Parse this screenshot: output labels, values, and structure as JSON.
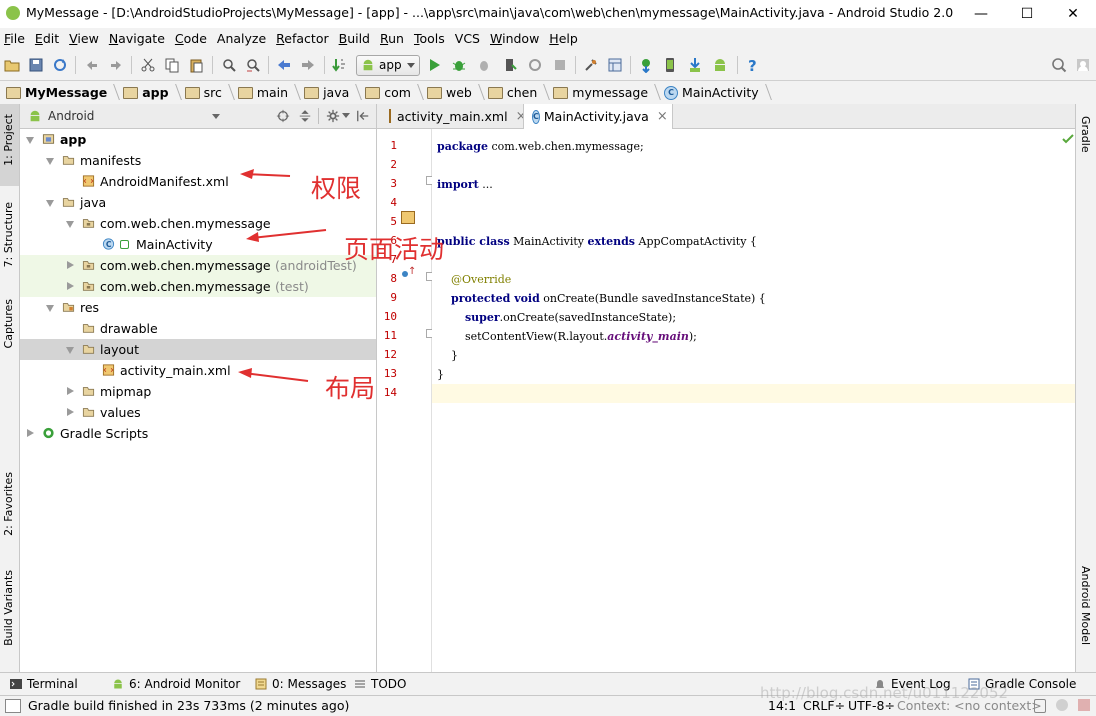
{
  "window": {
    "title": "MyMessage - [D:\\AndroidStudioProjects\\MyMessage] - [app] - ...\\app\\src\\main\\java\\com\\web\\chen\\mymessage\\MainActivity.java - Android Studio 2.0",
    "minimize": "—",
    "maximize": "☐",
    "close": "✕"
  },
  "menu": [
    {
      "label": "File",
      "u": "F",
      "rest": "ile"
    },
    {
      "label": "Edit",
      "u": "E",
      "rest": "dit"
    },
    {
      "label": "View",
      "u": "V",
      "rest": "iew"
    },
    {
      "label": "Navigate",
      "u": "N",
      "rest": "avigate"
    },
    {
      "label": "Code",
      "u": "C",
      "rest": "ode"
    },
    {
      "label": "Analyze",
      "u": "",
      "rest": "Analyze"
    },
    {
      "label": "Refactor",
      "u": "R",
      "rest": "efactor"
    },
    {
      "label": "Build",
      "u": "B",
      "rest": "uild"
    },
    {
      "label": "Run",
      "u": "R",
      "rest": "un"
    },
    {
      "label": "Tools",
      "u": "T",
      "rest": "ools"
    },
    {
      "label": "VCS",
      "u": "",
      "rest": "VCS"
    },
    {
      "label": "Window",
      "u": "W",
      "rest": "indow"
    },
    {
      "label": "Help",
      "u": "H",
      "rest": "elp"
    }
  ],
  "toolbar": {
    "run_config": "app"
  },
  "breadcrumb": [
    "MyMessage",
    "app",
    "src",
    "main",
    "java",
    "com",
    "web",
    "chen",
    "mymessage",
    "MainActivity"
  ],
  "left_tools": [
    "1: Project",
    "7: Structure",
    "Captures",
    "2: Favorites",
    "Build Variants"
  ],
  "right_tools": [
    "Gradle",
    "Android Model"
  ],
  "project": {
    "view": "Android",
    "tree": [
      {
        "label": "app",
        "sub": "",
        "depth": 0,
        "state": "open",
        "icon": "module-icon",
        "bold": true
      },
      {
        "label": "manifests",
        "sub": "",
        "depth": 1,
        "state": "open",
        "icon": "folder-icon"
      },
      {
        "label": "AndroidManifest.xml",
        "sub": "",
        "depth": 2,
        "state": "leaf",
        "icon": "xml-file-icon"
      },
      {
        "label": "java",
        "sub": "",
        "depth": 1,
        "state": "open",
        "icon": "folder-icon"
      },
      {
        "label": "com.web.chen.mymessage",
        "sub": "",
        "depth": 2,
        "state": "open",
        "icon": "package-icon"
      },
      {
        "label": "MainActivity",
        "sub": "",
        "depth": 3,
        "state": "leaf",
        "icon": "class-icon"
      },
      {
        "label": "com.web.chen.mymessage",
        "sub": "(androidTest)",
        "depth": 2,
        "state": "closed",
        "icon": "package-icon",
        "tint": "green"
      },
      {
        "label": "com.web.chen.mymessage",
        "sub": "(test)",
        "depth": 2,
        "state": "closed",
        "icon": "package-icon",
        "tint": "green"
      },
      {
        "label": "res",
        "sub": "",
        "depth": 1,
        "state": "open",
        "icon": "res-folder-icon"
      },
      {
        "label": "drawable",
        "sub": "",
        "depth": 2,
        "state": "leaf",
        "icon": "folder-icon"
      },
      {
        "label": "layout",
        "sub": "",
        "depth": 2,
        "state": "open",
        "icon": "folder-icon",
        "selected": true
      },
      {
        "label": "activity_main.xml",
        "sub": "",
        "depth": 3,
        "state": "leaf",
        "icon": "xml-file-icon"
      },
      {
        "label": "mipmap",
        "sub": "",
        "depth": 2,
        "state": "closed",
        "icon": "folder-icon"
      },
      {
        "label": "values",
        "sub": "",
        "depth": 2,
        "state": "closed",
        "icon": "folder-icon"
      },
      {
        "label": "Gradle Scripts",
        "sub": "",
        "depth": 0,
        "state": "closed",
        "icon": "gradle-icon"
      }
    ]
  },
  "annotations": {
    "permissions": "权限",
    "page_activity": "页面活动",
    "layout": "布局"
  },
  "editor": {
    "tabs": [
      {
        "label": "activity_main.xml",
        "close": "×",
        "active": false
      },
      {
        "label": "MainActivity.java",
        "close": "×",
        "active": true
      }
    ],
    "current_line": 14,
    "lines": [
      [
        {
          "t": "package",
          "c": "kw"
        },
        {
          "t": " com.web.chen.mymessage;",
          "c": ""
        }
      ],
      [],
      [
        {
          "t": "import",
          "c": "kw"
        },
        {
          "t": " ...",
          "c": ""
        }
      ],
      [],
      [],
      [
        {
          "t": "public class",
          "c": "kw"
        },
        {
          "t": " MainActivity ",
          "c": ""
        },
        {
          "t": "extends",
          "c": "kw"
        },
        {
          "t": " AppCompatActivity {",
          "c": ""
        }
      ],
      [],
      [
        {
          "t": "    @Override",
          "c": "ann"
        }
      ],
      [
        {
          "t": "    ",
          "c": ""
        },
        {
          "t": "protected void",
          "c": "kw"
        },
        {
          "t": " onCreate(Bundle savedInstanceState) {",
          "c": ""
        }
      ],
      [
        {
          "t": "        ",
          "c": ""
        },
        {
          "t": "super",
          "c": "kw"
        },
        {
          "t": ".onCreate(savedInstanceState);",
          "c": ""
        }
      ],
      [
        {
          "t": "        setContentView(R.layout.",
          "c": ""
        },
        {
          "t": "activity_main",
          "c": "fld"
        },
        {
          "t": ");",
          "c": ""
        }
      ],
      [
        {
          "t": "    }",
          "c": ""
        }
      ],
      [
        {
          "t": "}",
          "c": ""
        }
      ],
      []
    ]
  },
  "bottom_tools": [
    {
      "label": "Terminal",
      "u": ""
    },
    {
      "label": "6: Android Monitor",
      "u": "6"
    },
    {
      "label": "0: Messages",
      "u": "0"
    },
    {
      "label": "TODO",
      "u": ""
    },
    {
      "label": "Event Log",
      "u": ""
    },
    {
      "label": "Gradle Console",
      "u": ""
    }
  ],
  "status": {
    "message": "Gradle build finished in 23s 733ms (2 minutes ago)",
    "position": "14:1",
    "line_sep": "CRLF÷",
    "encoding": "UTF-8÷",
    "context": "Context: <no context>"
  },
  "watermark": "http://blog.csdn.net/u011122052",
  "colors": {
    "annotation": "#e03030",
    "keyword": "#000080",
    "line_number": "#c00000",
    "selected_row": "#d4d4d4",
    "test_row": "#eff8e6"
  }
}
